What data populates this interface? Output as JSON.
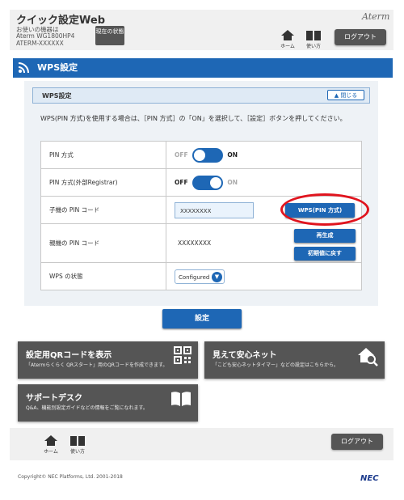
{
  "header": {
    "app_title": "クイック設定Web",
    "device_label": "お使いの機器は",
    "device_model": "Aterm WG1800HP4",
    "device_id": "ATERM-XXXXXX",
    "status_button": "現在の状態",
    "brand": "Aterm",
    "home_label": "ホーム",
    "help_label": "使い方",
    "logout_label": "ログアウト"
  },
  "banner": {
    "title": "WPS設定",
    "icon": "wifi-icon"
  },
  "section": {
    "title": "WPS設定",
    "close_label": "閉じる",
    "description": "WPS(PIN 方式)を使用する場合は、［PIN 方式］の「ON」を選択して、［設定］ボタンを押してください。"
  },
  "rows": {
    "pin_method": {
      "label": "PIN 方式",
      "off": "OFF",
      "on": "ON",
      "state": "on"
    },
    "pin_external": {
      "label": "PIN 方式(外部Registrar)",
      "off": "OFF",
      "on": "ON",
      "state": "off"
    },
    "child_pin": {
      "label": "子機の PIN コード",
      "value": "XXXXXXXX",
      "button": "WPS(PIN 方式)"
    },
    "parent_pin": {
      "label": "親機の PIN コード",
      "value": "XXXXXXXX",
      "regen": "再生成",
      "reset": "初期値に戻す"
    },
    "wps_status": {
      "label": "WPS の状態",
      "value": "Configured"
    }
  },
  "submit_label": "設定",
  "tiles": {
    "qr": {
      "title": "設定用QRコードを表示",
      "sub": "「Atermらくらく QRスタート」用のQRコードを作成できます。",
      "icon": "qr-code-icon"
    },
    "safety": {
      "title": "見えて安心ネット",
      "sub": "「こども安心ネットタイマー」などの設定はこちらから。",
      "icon": "home-search-icon"
    },
    "support": {
      "title": "サポートデスク",
      "sub": "Q&A、機能別設定ガイドなどの情報をご覧になれます。",
      "icon": "book-icon"
    }
  },
  "footer": {
    "home_label": "ホーム",
    "help_label": "使い方",
    "logout_label": "ログアウト",
    "copyright": "Copyright© NEC Platforms, Ltd. 2001-2018",
    "brand": "NEC"
  },
  "colors": {
    "accent": "#1e67b5",
    "dark": "#555555",
    "highlight_ring": "#e0141e"
  }
}
